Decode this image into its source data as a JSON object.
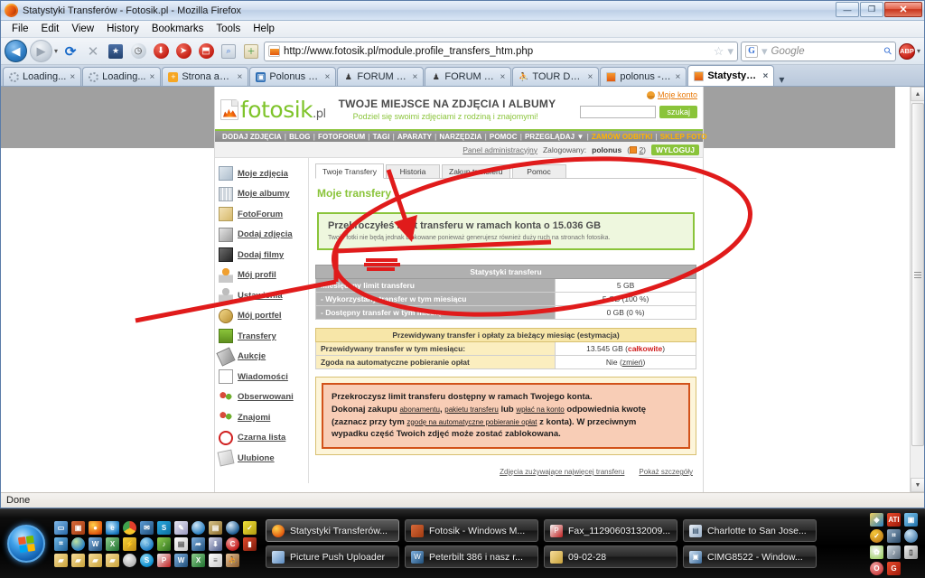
{
  "window": {
    "title": "Statystyki Transferów - Fotosik.pl - Mozilla Firefox",
    "minimize": "—",
    "maximize": "❐",
    "close": "✕"
  },
  "menubar": [
    {
      "label": "File"
    },
    {
      "label": "Edit"
    },
    {
      "label": "View"
    },
    {
      "label": "History"
    },
    {
      "label": "Bookmarks"
    },
    {
      "label": "Tools"
    },
    {
      "label": "Help"
    }
  ],
  "toolbar": {
    "back": "◀",
    "forward": "▶",
    "dropdown_caret": "▾",
    "reload": "⟳",
    "stop": "✕",
    "bookmark_star": "★",
    "history_clock": "🕐",
    "url": "http://www.fotosik.pl/module.profile_transfers_htm.php",
    "url_star": "☆",
    "url_star_caret": "▾",
    "search_engine": "G",
    "search_placeholder": "Google",
    "search_caret": "▾",
    "adblock_label": "ABP",
    "overflow_caret": "▾"
  },
  "tabs": [
    {
      "label": "Loading...",
      "icon": "spinner",
      "close": "×",
      "active": false
    },
    {
      "label": "Loading...",
      "icon": "spinner",
      "close": "×",
      "active": false
    },
    {
      "label": "Strona admini...",
      "icon": "plus-orange",
      "close": "×",
      "active": false
    },
    {
      "label": "Polonus - Pict...",
      "icon": "blue-square",
      "close": "×",
      "active": false
    },
    {
      "label": "FORUM :: Nap...",
      "icon": "forum",
      "close": "×",
      "active": false
    },
    {
      "label": "FORUM :: Zob...",
      "icon": "forum",
      "close": "×",
      "active": false
    },
    {
      "label": "TOUR DE USA...",
      "icon": "red-person",
      "close": "×",
      "active": false
    },
    {
      "label": "polonus - stro...",
      "icon": "fotosik",
      "close": "×",
      "active": false
    },
    {
      "label": "Statystyki Tr...",
      "icon": "fotosik",
      "close": "×",
      "active": true
    }
  ],
  "tab_overflow": "▾",
  "site": {
    "logo_text": "fotosik",
    "logo_suffix": ".pl",
    "slogan_main": "TWOJE MIEJSCE NA ZDJĘCIA I ALBUMY",
    "slogan_sub": "Podziel się swoimi zdjęciami z rodziną i znajomymi!",
    "my_account": "Moje konto",
    "search_button": "szukaj",
    "nav": [
      {
        "label": "DODAJ ZDJĘCIA",
        "highlight": false
      },
      {
        "label": "BLOG",
        "highlight": false
      },
      {
        "label": "FOTOFORUM",
        "highlight": false
      },
      {
        "label": "TAGI",
        "highlight": false
      },
      {
        "label": "APARATY",
        "highlight": false
      },
      {
        "label": "NARZĘDZIA",
        "highlight": false
      },
      {
        "label": "POMOC",
        "highlight": false
      },
      {
        "label": "PRZEGLĄDAJ ▼",
        "highlight": false
      },
      {
        "label": "ZAMÓW ODBITKI",
        "highlight": true
      },
      {
        "label": "SKLEP FOTO",
        "highlight": true
      }
    ],
    "admin_panel": "Panel administracyjny",
    "logged_as_prefix": "Zalogowany:",
    "logged_user": "polonus",
    "message_count": "2",
    "logout": "WYLOGUJ"
  },
  "sidebar": {
    "items": [
      {
        "label": "Moje zdjęcia",
        "icon": "photo-icon"
      },
      {
        "label": "Moje albumy",
        "icon": "albums-icon"
      },
      {
        "label": "FotoForum",
        "icon": "forum-icon"
      },
      {
        "label": "Dodaj zdjęcia",
        "icon": "add-photo-icon"
      },
      {
        "label": "Dodaj filmy",
        "icon": "add-video-icon"
      },
      {
        "label": "Mój profil",
        "icon": "profile-icon"
      },
      {
        "label": "Ustawienia",
        "icon": "settings-icon"
      },
      {
        "label": "Mój portfel",
        "icon": "wallet-icon"
      },
      {
        "label": "Transfery",
        "icon": "transfer-icon"
      },
      {
        "label": "Aukcje",
        "icon": "auction-icon"
      },
      {
        "label": "Wiadomości",
        "icon": "mail-icon"
      },
      {
        "label": "Obserwowani",
        "icon": "watched-icon"
      },
      {
        "label": "Znajomi",
        "icon": "friends-icon"
      },
      {
        "label": "Czarna lista",
        "icon": "blacklist-icon"
      },
      {
        "label": "Ulubione",
        "icon": "favorites-icon"
      }
    ]
  },
  "content": {
    "tabs": [
      {
        "label": "Twoje Transfery",
        "active": true
      },
      {
        "label": "Historia",
        "active": false
      },
      {
        "label": "Zakup transferu",
        "active": false
      },
      {
        "label": "Pomoc",
        "active": false
      }
    ],
    "section_title": "Moje transfery",
    "alert": {
      "title": "Przekroczyłeś limit transferu w ramach konta o 15.036 GB",
      "subtitle": "Twoje fotki nie będą jednak blokowane ponieważ generujesz również duży ruch na stronach fotosika."
    },
    "stats_table": {
      "header": "Statystyki transferu",
      "rows": [
        {
          "label": "Miesięczny limit transferu",
          "value": "5 GB"
        },
        {
          "label": "- Wykorzystany transfer w tym miesiącu",
          "value": "5 GB (100 %)"
        },
        {
          "label": "- Dostępny transfer w tym miesiącu",
          "value": "0 GB (0 %)"
        }
      ]
    },
    "estimate_table": {
      "header": "Przewidywany transfer i opłaty za bieżący miesiąc (estymacja)",
      "rows": [
        {
          "label": "Przewidywany transfer w tym miesiącu:",
          "value": "13.545 GB",
          "value_note": "całkowite"
        },
        {
          "label": "Zgoda na automatyczne pobieranie opłat",
          "value": "Nie",
          "value_note": "zmień"
        }
      ]
    },
    "warning": {
      "line1": "Przekroczysz limit transferu dostępny w ramach Twojego konta.",
      "line2_a": "Dokonaj zakupu ",
      "link1": "abonamentu",
      "line2_b": ", ",
      "link2": "pakietu transferu",
      "line2_c": " lub ",
      "link3": "wpłać na konto",
      "line2_d": " odpowiednia kwotę",
      "line3_a": "(zaznacz przy tym ",
      "link4": "zgodę na automatyczne pobieranie opłat",
      "line3_b": " z konta). W przeciwnym",
      "line4": "wypadku część Twoich zdjęć może zostać zablokowana."
    },
    "footer_links": [
      {
        "label": "Zdjęcia zużywające najwięcej transferu"
      },
      {
        "label": "Pokaż szczegóły"
      }
    ]
  },
  "statusbar": {
    "text": "Done"
  },
  "taskbar": {
    "start_label": "Start",
    "tasks_row1": [
      {
        "label": "Statystyki Transferów...",
        "icon": "firefox-icon",
        "active": true
      },
      {
        "label": "Fotosik - Windows M...",
        "icon": "photo-viewer-icon",
        "active": false
      },
      {
        "label": "Fax_11290603132009...",
        "icon": "pdf-icon",
        "active": false
      },
      {
        "label": "Charlotte to San Jose...",
        "icon": "document-icon",
        "active": false
      }
    ],
    "tasks_row2": [
      {
        "label": "Picture Push Uploader",
        "icon": "uploader-icon",
        "active": false
      },
      {
        "label": "Peterbilt 386 i nasz r...",
        "icon": "word-icon",
        "active": false
      },
      {
        "label": "09-02-28",
        "icon": "folder-icon",
        "active": false
      },
      {
        "label": "CIMG8522 - Window...",
        "icon": "image-icon",
        "active": false
      }
    ]
  },
  "colors": {
    "brand_green": "#8ac43a",
    "accent_orange": "#e87b0c",
    "annotation_red": "#e01b1b",
    "warning_border": "#d2521a",
    "warning_bg": "#f8cdb6"
  }
}
